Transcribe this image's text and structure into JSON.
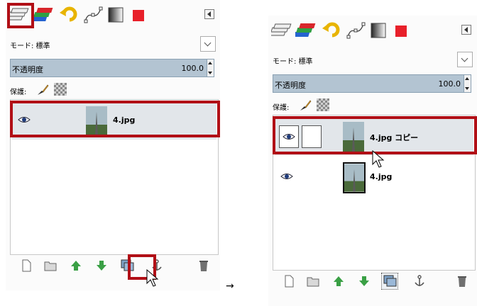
{
  "before": {
    "mode_label": "モード: 標準",
    "opacity_label": "不透明度",
    "opacity_value": "100.0",
    "lock_label": "保護:",
    "layers": [
      {
        "name": "4.jpg",
        "visible": true,
        "selected": true
      }
    ]
  },
  "after": {
    "mode_label": "モード: 標準",
    "opacity_label": "不透明度",
    "opacity_value": "100.0",
    "lock_label": "保護:",
    "layers": [
      {
        "name": "4.jpg コピー",
        "visible": true,
        "selected": true
      },
      {
        "name": "4.jpg",
        "visible": true,
        "selected": false
      }
    ]
  },
  "transition_arrow": "→",
  "tab_icons": [
    "layers-icon",
    "channels-icon",
    "undo-history-icon",
    "paths-icon",
    "gradients-icon",
    "color-swatch-icon"
  ],
  "bottom_buttons": [
    "new-layer-icon",
    "new-layer-group-icon",
    "raise-layer-icon",
    "lower-layer-icon",
    "duplicate-layer-icon",
    "anchor-layer-icon",
    "delete-layer-icon"
  ],
  "colors": {
    "highlight": "#b10f16",
    "opacity_bar": "#b3c4d2",
    "selected_row": "#e2e6ea"
  }
}
